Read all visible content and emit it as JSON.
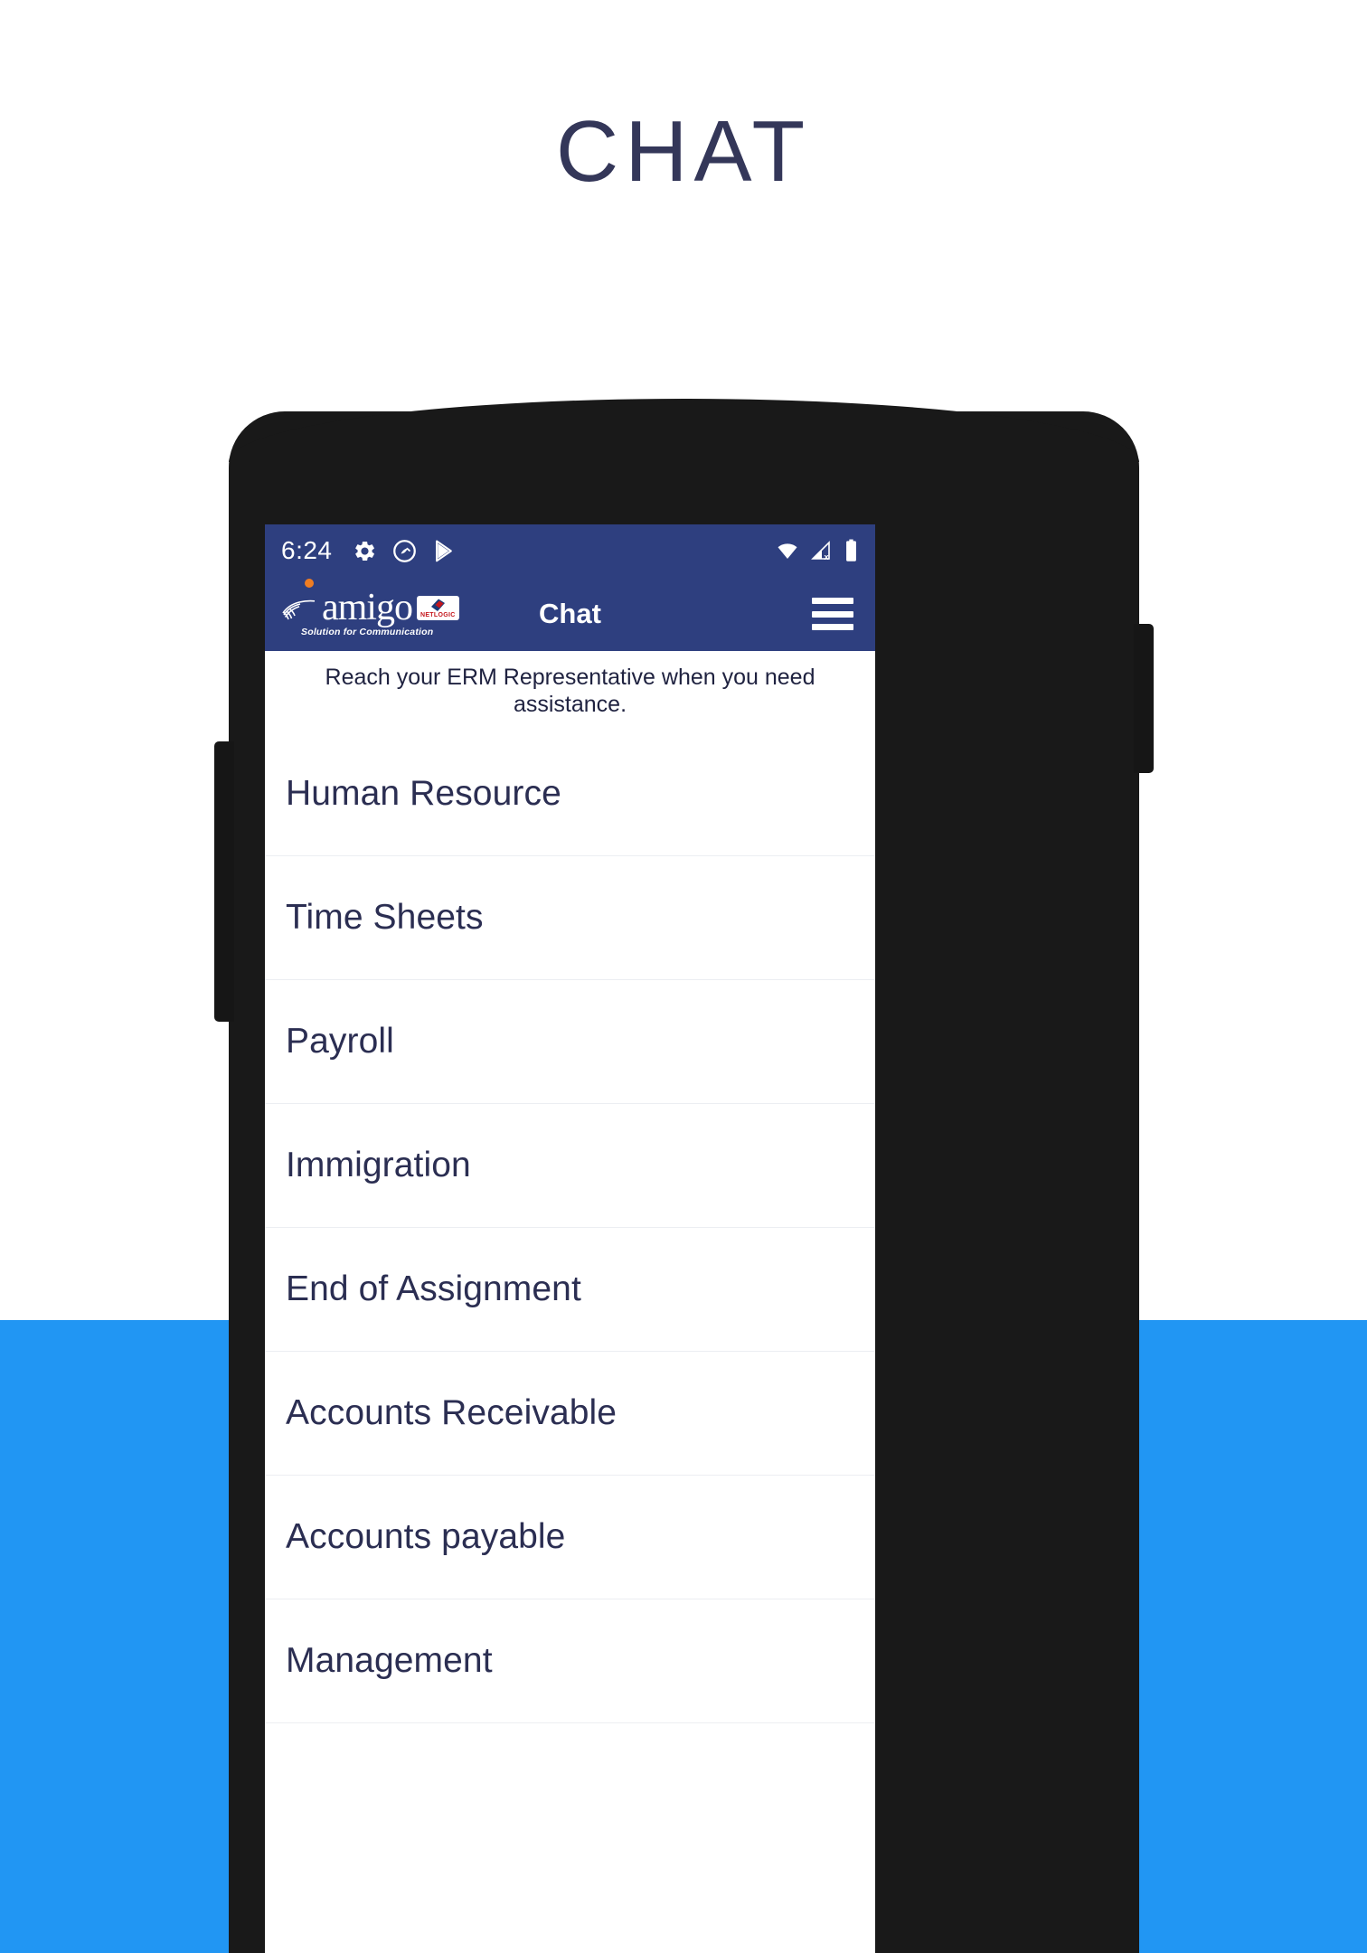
{
  "page": {
    "headline": "CHAT",
    "headline_color": "#343759",
    "background_color": "#ffffff",
    "band_color": "#2196f3"
  },
  "phone": {
    "body_color": "#191919",
    "sensor_icon": "proximity-sensor-dot",
    "camera_icon": "front-camera-lens",
    "left_button": "volume-rocker",
    "right_button": "power-button"
  },
  "status_bar": {
    "time": "6:24",
    "background_color": "#2e3f7f",
    "left_icons": [
      "gear-icon",
      "circle-q-icon",
      "play-store-icon"
    ],
    "right_icons": [
      "wifi-icon",
      "cellular-no-sim-icon",
      "battery-icon"
    ]
  },
  "app_bar": {
    "title": "Chat",
    "background_color": "#2e3f7f",
    "logo": {
      "word": "amigo",
      "tagline": "Solution for Communication",
      "badge_text": "NETLOGIC",
      "handshake_icon": "handshake-icon",
      "dot_color": "#f07d22",
      "badge_color": "#c4161c"
    },
    "menu_icon": "hamburger-menu-icon"
  },
  "content": {
    "subtitle": "Reach your ERM Representative when you need assistance.",
    "items": [
      {
        "label": "Human Resource"
      },
      {
        "label": "Time Sheets"
      },
      {
        "label": "Payroll"
      },
      {
        "label": "Immigration"
      },
      {
        "label": "End of Assignment"
      },
      {
        "label": "Accounts Receivable"
      },
      {
        "label": "Accounts payable"
      },
      {
        "label": "Management"
      }
    ]
  }
}
